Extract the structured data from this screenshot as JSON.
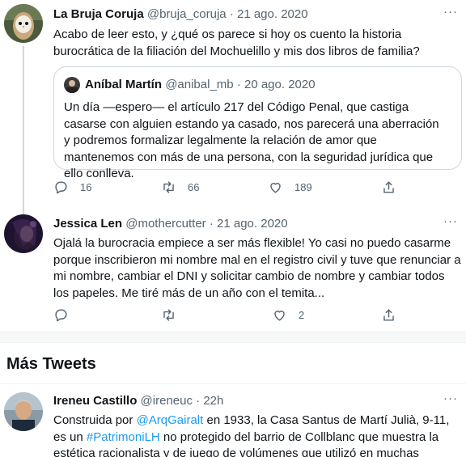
{
  "tweets": [
    {
      "name": "La Bruja Coruja",
      "handle": "@bruja_coruja",
      "dot": "·",
      "date": "21 ago. 2020",
      "more": "···",
      "text": "Acabo de leer esto, y ¿qué os parece si hoy os cuento la historia burocrática de la filiación del Mochuelillo y mis dos libros de familia?",
      "quote": {
        "name": "Aníbal Martín",
        "handle": "@anibal_mb",
        "dot": "·",
        "date": "20 ago. 2020",
        "text": "Un día —espero— el artículo 217 del Código Penal, que castiga casarse con alguien estando ya casado, nos parecerá una aberración y podremos formalizar legalmente la relación de amor que mantenemos con más de una persona, con la seguridad jurídica que ello conlleva."
      },
      "replies": "16",
      "retweets": "66",
      "likes": "189"
    },
    {
      "name": "Jessica Len",
      "handle": "@mothercutter",
      "dot": "·",
      "date": "21 ago. 2020",
      "more": "···",
      "text": "Ojalá la burocracia empiece a ser más flexible! Yo casi no puedo casarme porque inscribieron mi nombre mal en el registro civil y tuve que renunciar a mi nombre, cambiar el DNI y solicitar cambio de nombre y cambiar todos los papeles. Me tiré más de un año con el temita...",
      "replies": "",
      "retweets": "",
      "likes": "2"
    }
  ],
  "more_tweets": {
    "title": "Más Tweets",
    "tweet": {
      "name": "Ireneu Castillo",
      "handle": "@ireneuc",
      "dot": "·",
      "date": "22h",
      "more": "···",
      "text_1": "Construida por ",
      "mention": "@ArqGairalt",
      "text_2": " en 1933, la Casa Santus de Martí Julià, 9-11, es un ",
      "hashtag": "#PatrimoniLH",
      "text_3": " no protegido del barrio de Collblanc que muestra la estética racionalista y de juego de volúmenes que utilizó en muchas"
    }
  },
  "colors": {
    "accent": "#1d9bf0",
    "muted": "#536471",
    "border": "#cfd9de"
  }
}
